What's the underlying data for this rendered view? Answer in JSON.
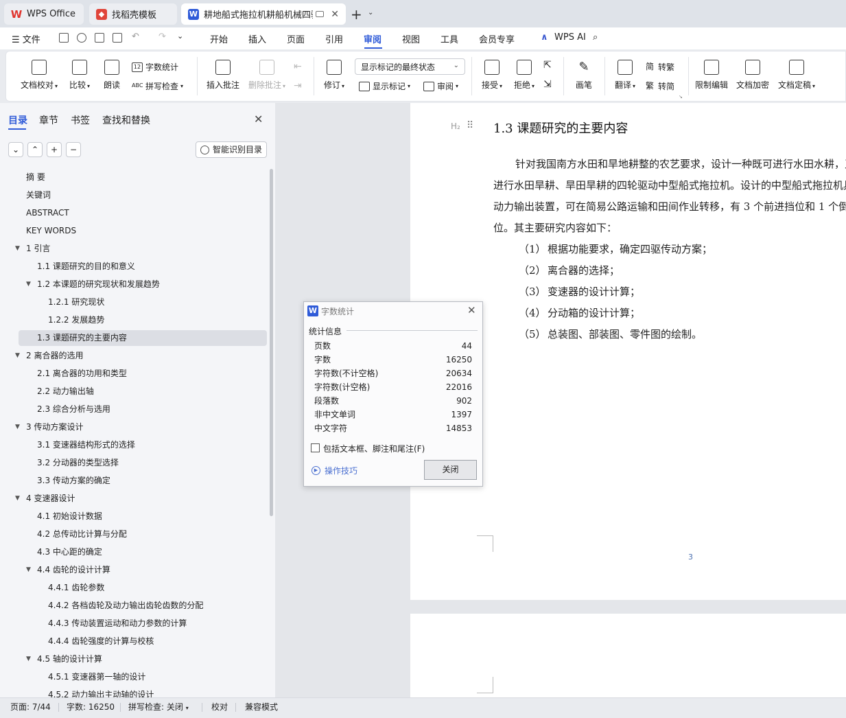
{
  "tabs": {
    "wps_home": "WPS Office",
    "template": "找稻壳模板",
    "document": "耕地船式拖拉机耕船机械四驱传动系统设计"
  },
  "menu": {
    "file": "文件",
    "items": [
      "开始",
      "插入",
      "页面",
      "引用",
      "审阅",
      "视图",
      "工具",
      "会员专享"
    ],
    "active": "审阅",
    "wps_ai": "WPS AI"
  },
  "ribbon": {
    "doc_proofread": "文档校对",
    "compare": "比较",
    "read_aloud": "朗读",
    "word_count": "字数统计",
    "spell_check": "拼写检查",
    "insert_comment": "插入批注",
    "delete_comment": "删除批注",
    "track_changes": "修订",
    "markup_state": "显示标记的最终状态",
    "show_markup": "显示标记",
    "review": "审阅",
    "accept": "接受",
    "reject": "拒绝",
    "pen": "画笔",
    "translate": "翻译",
    "to_traditional": "转繁",
    "to_simplified": "转简",
    "restrict_edit": "限制编辑",
    "encrypt": "文档加密",
    "finalize": "文档定稿"
  },
  "nav": {
    "tabs": [
      "目录",
      "章节",
      "书签",
      "查找和替换"
    ],
    "smart_toc": "智能识别目录",
    "toc": [
      {
        "label": "摘  要",
        "level": 0
      },
      {
        "label": "关键词",
        "level": 0
      },
      {
        "label": "ABSTRACT",
        "level": 0
      },
      {
        "label": "KEY WORDS",
        "level": 0
      },
      {
        "label": "1 引言",
        "level": 0,
        "expanded": true
      },
      {
        "label": "1.1 课题研究的目的和意义",
        "level": 1
      },
      {
        "label": "1.2 本课题的研究现状和发展趋势",
        "level": 1,
        "expanded": true
      },
      {
        "label": "1.2.1 研究现状",
        "level": 2
      },
      {
        "label": "1.2.2 发展趋势",
        "level": 2
      },
      {
        "label": "1.3 课题研究的主要内容",
        "level": 1,
        "selected": true
      },
      {
        "label": "2 离合器的选用",
        "level": 0,
        "expanded": true
      },
      {
        "label": "2.1 离合器的功用和类型",
        "level": 1
      },
      {
        "label": "2.2 动力输出轴",
        "level": 1
      },
      {
        "label": "2.3 综合分析与选用",
        "level": 1
      },
      {
        "label": "3  传动方案设计",
        "level": 0,
        "expanded": true
      },
      {
        "label": "3.1  变速器结构形式的选择",
        "level": 1
      },
      {
        "label": "3.2  分动器的类型选择",
        "level": 1
      },
      {
        "label": "3.3  传动方案的确定",
        "level": 1
      },
      {
        "label": "4  变速器设计",
        "level": 0,
        "expanded": true
      },
      {
        "label": "4.1  初始设计数据",
        "level": 1
      },
      {
        "label": "4.2  总传动比计算与分配",
        "level": 1
      },
      {
        "label": "4.3  中心距的确定",
        "level": 1
      },
      {
        "label": "4.4  齿轮的设计计算",
        "level": 1,
        "expanded": true
      },
      {
        "label": "4.4.1  齿轮参数",
        "level": 2
      },
      {
        "label": "4.4.2  各档齿轮及动力输出齿轮齿数的分配",
        "level": 2
      },
      {
        "label": "4.4.3  传动装置运动和动力参数的计算",
        "level": 2
      },
      {
        "label": "4.4.4  齿轮强度的计算与校核",
        "level": 2
      },
      {
        "label": "4.5  轴的设计计算",
        "level": 1,
        "expanded": true
      },
      {
        "label": "4.5.1  变速器第一轴的设计",
        "level": 2
      },
      {
        "label": "4.5.2  动力输出主动轴的设计",
        "level": 2
      }
    ]
  },
  "document": {
    "heading_badge": "H₂",
    "heading": "1.3 课题研究的主要内容",
    "paragraph_lines": [
      "针对我国南方水田和旱地耕整的农艺要求，设计一种既可进行水田水耕，又可",
      "进行水田旱耕、旱田旱耕的四轮驱动中型船式拖拉机。设计的中型船式拖拉机具有",
      "动力输出装置，可在简易公路运输和田间作业转移，有 3 个前进挡位和 1 个倒挡",
      "位。其主要研究内容如下："
    ],
    "list": [
      {
        "num": "（1）",
        "text": "根据功能要求，确定四驱传动方案；"
      },
      {
        "num": "（2）",
        "text": "离合器的选择；"
      },
      {
        "num": "（3）",
        "text": "变速器的设计计算；"
      },
      {
        "num": "（4）",
        "text": "分动箱的设计计算；"
      },
      {
        "num": "（5）",
        "text": "总装图、部装图、零件图的绘制。"
      }
    ],
    "page_number": "3"
  },
  "dialog": {
    "title": "字数统计",
    "section": "统计信息",
    "stats": [
      {
        "label": "页数",
        "value": "44"
      },
      {
        "label": "字数",
        "value": "16250"
      },
      {
        "label": "字符数(不计空格)",
        "value": "20634"
      },
      {
        "label": "字符数(计空格)",
        "value": "22016"
      },
      {
        "label": "段落数",
        "value": "902"
      },
      {
        "label": "非中文单词",
        "value": "1397"
      },
      {
        "label": "中文字符",
        "value": "14853"
      }
    ],
    "include_label": "包括文本框、脚注和尾注(F)",
    "include_checked": false,
    "tips": "操作技巧",
    "close": "关闭"
  },
  "status": {
    "page": "页面: 7/44",
    "words": "字数: 16250",
    "spell": "拼写检查: 关闭",
    "proof": "校对",
    "compat": "兼容模式"
  },
  "colors": {
    "accent": "#2f5bd8",
    "wps_red": "#e0332c"
  }
}
